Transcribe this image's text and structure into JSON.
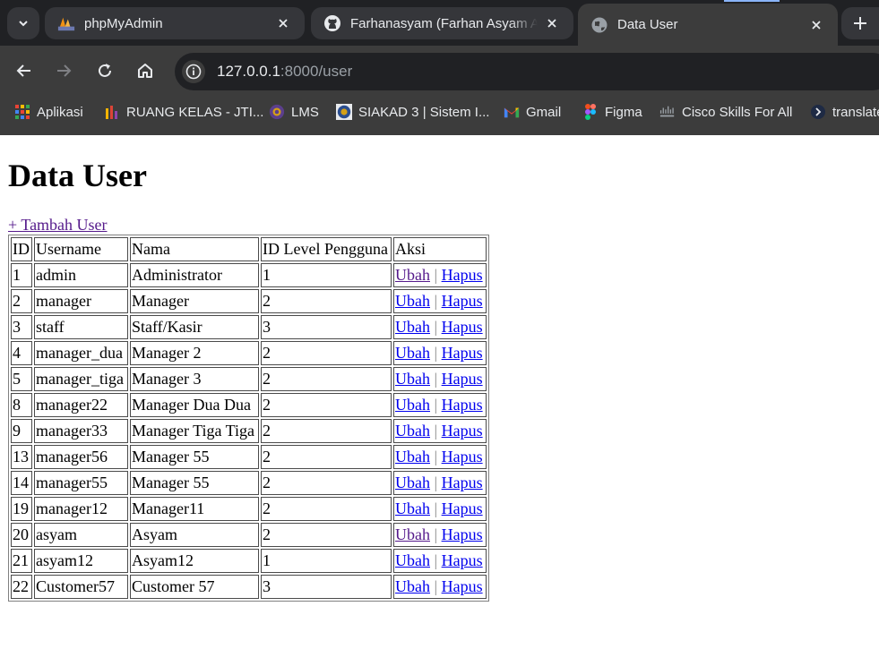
{
  "browser": {
    "tabs": [
      {
        "title": "phpMyAdmin",
        "icon": "phpmyadmin-icon",
        "active": false
      },
      {
        "title": "Farhanasyam (Farhan Asyam Alf",
        "icon": "github-icon",
        "active": false
      },
      {
        "title": "Data User",
        "icon": "globe-icon",
        "active": true
      }
    ],
    "url": {
      "host": "127.0.0.1",
      "path": ":8000/user"
    },
    "bookmarks": [
      {
        "label": "Aplikasi",
        "icon": "apps-grid-icon"
      },
      {
        "label": "RUANG KELAS - JTI...",
        "icon": "ruang-kelas-icon"
      },
      {
        "label": "LMS",
        "icon": "lms-icon"
      },
      {
        "label": "SIAKAD 3 | Sistem I...",
        "icon": "siakad-icon"
      },
      {
        "label": "Gmail",
        "icon": "gmail-icon"
      },
      {
        "label": "Figma",
        "icon": "figma-icon"
      },
      {
        "label": "Cisco Skills For All",
        "icon": "cisco-icon"
      },
      {
        "label": "translate",
        "icon": "translate-icon"
      }
    ]
  },
  "page": {
    "title": "Data User",
    "add_link": "+ Tambah User",
    "table": {
      "headers": [
        "ID",
        "Username",
        "Nama",
        "ID Level Pengguna",
        "Aksi"
      ],
      "edit_label": "Ubah",
      "separator": "|",
      "delete_label": "Hapus",
      "rows": [
        {
          "id": "1",
          "username": "admin",
          "nama": "Administrator",
          "level": "1",
          "edit_visited": true
        },
        {
          "id": "2",
          "username": "manager",
          "nama": "Manager",
          "level": "2",
          "edit_visited": false
        },
        {
          "id": "3",
          "username": "staff",
          "nama": "Staff/Kasir",
          "level": "3",
          "edit_visited": false
        },
        {
          "id": "4",
          "username": "manager_dua",
          "nama": "Manager 2",
          "level": "2",
          "edit_visited": false
        },
        {
          "id": "5",
          "username": "manager_tiga",
          "nama": "Manager 3",
          "level": "2",
          "edit_visited": false
        },
        {
          "id": "8",
          "username": "manager22",
          "nama": "Manager Dua Dua",
          "level": "2",
          "edit_visited": false
        },
        {
          "id": "9",
          "username": "manager33",
          "nama": "Manager Tiga Tiga",
          "level": "2",
          "edit_visited": false
        },
        {
          "id": "13",
          "username": "manager56",
          "nama": "Manager 55",
          "level": "2",
          "edit_visited": false
        },
        {
          "id": "14",
          "username": "manager55",
          "nama": "Manager 55",
          "level": "2",
          "edit_visited": false
        },
        {
          "id": "19",
          "username": "manager12",
          "nama": "Manager11",
          "level": "2",
          "edit_visited": false
        },
        {
          "id": "20",
          "username": "asyam",
          "nama": "Asyam",
          "level": "2",
          "edit_visited": true
        },
        {
          "id": "21",
          "username": "asyam12",
          "nama": "Asyam12",
          "level": "1",
          "edit_visited": false
        },
        {
          "id": "22",
          "username": "Customer57",
          "nama": "Customer 57",
          "level": "3",
          "edit_visited": false
        }
      ]
    }
  },
  "colors": {
    "link": "#0000ee",
    "visited_link": "#551a8b",
    "chrome_dark": "#202124",
    "chrome_toolbar": "#3c3c3c"
  }
}
